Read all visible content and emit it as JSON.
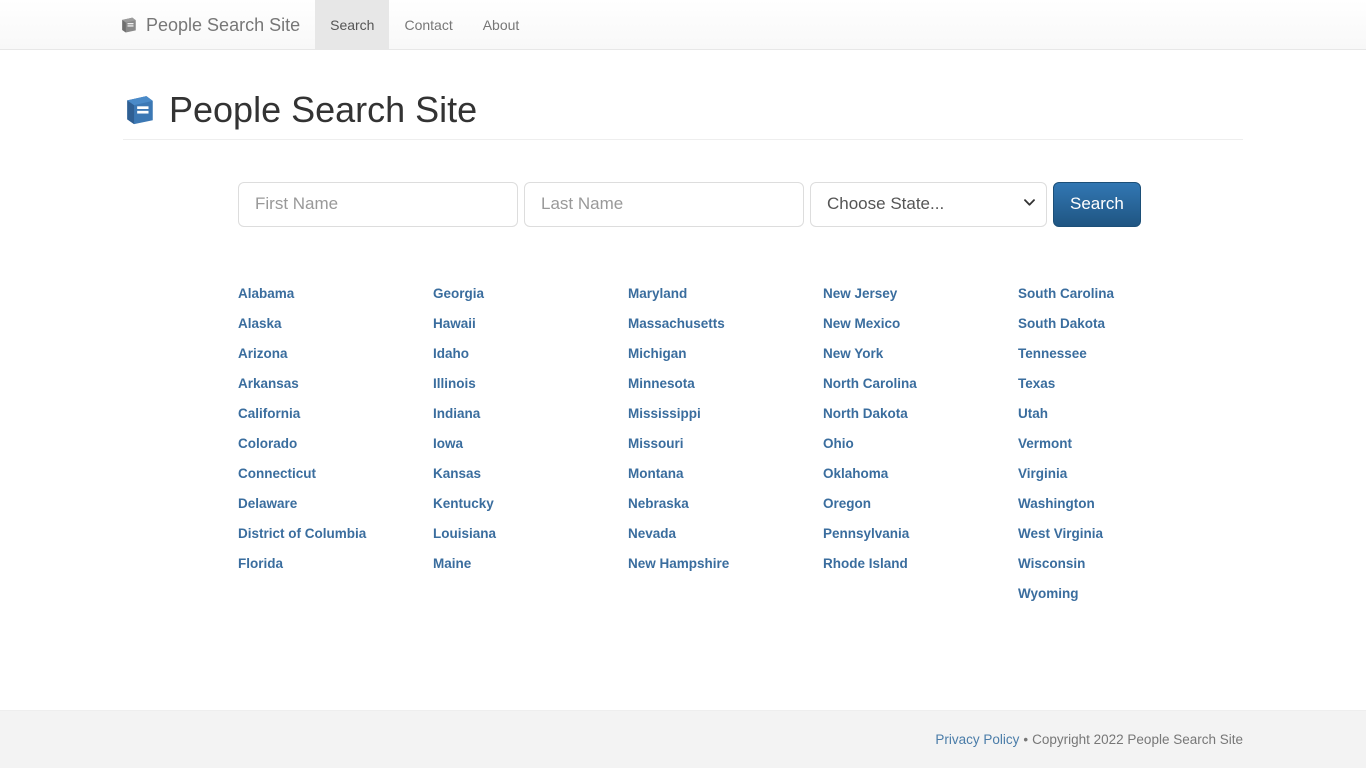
{
  "navbar": {
    "brand_icon": "book-icon",
    "brand_label": "People Search Site",
    "items": [
      {
        "label": "Search",
        "active": true
      },
      {
        "label": "Contact",
        "active": false
      },
      {
        "label": "About",
        "active": false
      }
    ]
  },
  "header": {
    "icon": "book-icon",
    "title": "People Search Site"
  },
  "search": {
    "first_name": {
      "placeholder": "First Name",
      "value": ""
    },
    "last_name": {
      "placeholder": "Last Name",
      "value": ""
    },
    "state_select": {
      "selected": "Choose State...",
      "chevron_icon": "chevron-down-icon"
    },
    "submit_label": "Search"
  },
  "states": {
    "columns": [
      [
        "Alabama",
        "Alaska",
        "Arizona",
        "Arkansas",
        "California",
        "Colorado",
        "Connecticut",
        "Delaware",
        "District of Columbia",
        "Florida"
      ],
      [
        "Georgia",
        "Hawaii",
        "Idaho",
        "Illinois",
        "Indiana",
        "Iowa",
        "Kansas",
        "Kentucky",
        "Louisiana",
        "Maine"
      ],
      [
        "Maryland",
        "Massachusetts",
        "Michigan",
        "Minnesota",
        "Mississippi",
        "Missouri",
        "Montana",
        "Nebraska",
        "Nevada",
        "New Hampshire"
      ],
      [
        "New Jersey",
        "New Mexico",
        "New York",
        "North Carolina",
        "North Dakota",
        "Ohio",
        "Oklahoma",
        "Oregon",
        "Pennsylvania",
        "Rhode Island"
      ],
      [
        "South Carolina",
        "South Dakota",
        "Tennessee",
        "Texas",
        "Utah",
        "Vermont",
        "Virginia",
        "Washington",
        "West Virginia",
        "Wisconsin",
        "Wyoming"
      ]
    ]
  },
  "footer": {
    "privacy_label": "Privacy Policy",
    "separator": "•",
    "copyright": "Copyright 2022 People Search Site"
  },
  "colors": {
    "brand_blue": "#3a6d9e",
    "button_blue": "#2b6ca3",
    "nav_gray": "#777777",
    "footer_bg": "#f3f3f3",
    "active_tab_bg": "#e7e7e7"
  }
}
